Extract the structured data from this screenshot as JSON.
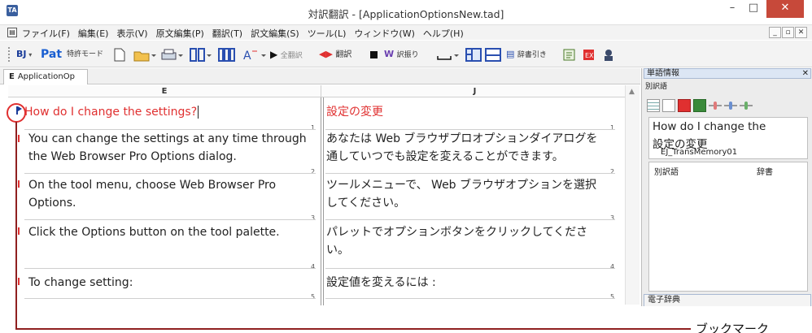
{
  "window": {
    "app_icon_text": "TA",
    "title": "対訳翻訳 - [ApplicationOptionsNew.tad]",
    "minimize": "–",
    "maximize": "□",
    "close": "✕"
  },
  "menu": {
    "items": [
      "ファイル(F)",
      "編集(E)",
      "表示(V)",
      "原文編集(P)",
      "翻訳(T)",
      "訳文編集(S)",
      "ツール(L)",
      "ウィンドウ(W)",
      "ヘルプ(H)"
    ],
    "mdi": [
      "_",
      "▫",
      "✕"
    ]
  },
  "toolbar": {
    "bj_label": "BJ",
    "pat_label": "Pat",
    "patent_mode": "特許モード",
    "translate_all": "全翻訳",
    "translate": "翻訳",
    "furigana": "訳振り",
    "dict_lookup": "辞書引き"
  },
  "tab": {
    "prefix": "E",
    "label": "ApplicationOp"
  },
  "editor": {
    "col_e": "E",
    "col_j": "J",
    "segments": [
      {
        "num": "1",
        "en": [
          "How do I change the settings?"
        ],
        "ja": [
          "設定の変更"
        ],
        "highlight": true
      },
      {
        "num": "2",
        "en": [
          "You can change the settings at any time through",
          "the Web Browser Pro Options dialog."
        ],
        "ja": [
          "あなたは Web ブラウザプロオプションダイアログを",
          "通していつでも設定を変えることができます。"
        ]
      },
      {
        "num": "3",
        "en": [
          "On the tool menu, choose Web Browser Pro",
          "Options."
        ],
        "ja": [
          "ツールメニューで、 Web ブラウザオプションを選択",
          "してください。"
        ]
      },
      {
        "num": "4",
        "en": [
          "Click the Options button on the tool palette."
        ],
        "ja": [
          "パレットでオプションボタンをクリックしてくださ",
          "い。"
        ]
      },
      {
        "num": "5",
        "en": [
          "To change setting:"
        ],
        "ja": [
          "設定値を変えるには :"
        ]
      }
    ]
  },
  "callout": {
    "label": "ブックマーク"
  },
  "word_info": {
    "title": "単語情報",
    "close": "✕",
    "alt_label": "別訳語",
    "source": "How do I change the",
    "target": "設定の変更",
    "memory": "EJ_TransMemory01",
    "col_alt": "別訳語",
    "col_dict": "辞書",
    "dict_pane": "電子辞典"
  },
  "colors": {
    "accent_red": "#e03030",
    "bookmark_blue": "#1a3c99",
    "close_red": "#c7493a"
  }
}
